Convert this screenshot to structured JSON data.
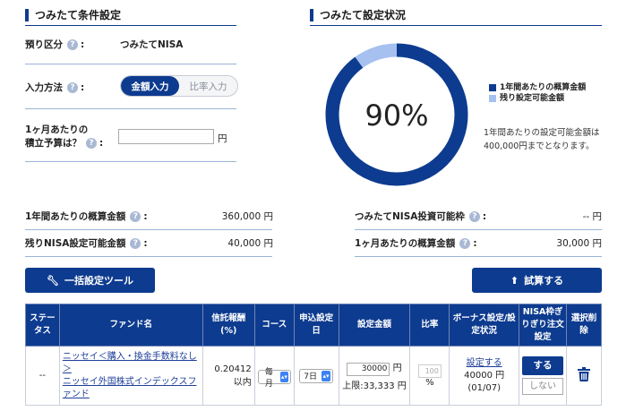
{
  "left": {
    "title": "つみたて条件設定",
    "account_label": "預り区分",
    "account_value": "つみたてNISA",
    "input_method_label": "入力方法",
    "method_amount": "金額入力",
    "method_ratio": "比率入力",
    "budget_label_1": "1ヶ月あたりの",
    "budget_label_2": "積立予算は？",
    "budget_unit": "円",
    "annual_label": "1年間あたりの概算金額",
    "annual_value": "360,000 円",
    "remain_label": "残りNISA設定可能金額",
    "remain_value": "40,000 円",
    "bulk_tool": "一括設定ツール"
  },
  "right": {
    "title": "つみたて設定状況",
    "percent": "90%",
    "percent_value": 90,
    "legend_annual": "1年間あたりの概算金額",
    "legend_remain": "残り設定可能金額",
    "note_1": "1年間あたりの設定可能金額は",
    "note_2": "400,000円までとなります。",
    "invest_limit_label": "つみたてNISA投資可能枠",
    "invest_limit_value": "-- 円",
    "monthly_label": "1ヶ月あたりの概算金額",
    "monthly_value": "30,000 円",
    "trial_button": "試算する"
  },
  "colors": {
    "primary": "#0d3b8f",
    "light": "#a6c0f0"
  },
  "icons": {
    "help": "question-icon",
    "wrench": "wrench-icon",
    "arrow": "arrow-circle-icon",
    "trash": "trash-icon"
  },
  "table": {
    "headers": [
      "ステータス",
      "ファンド名",
      "信託報酬(%)",
      "コース",
      "申込設定日",
      "設定金額",
      "比率",
      "ボーナス設定/設定状況",
      "NISA枠ぎりぎり注文設定",
      "選択削除"
    ],
    "row": {
      "status": "--",
      "fund_1": "ニッセイ＜購入・換金手数料なし＞",
      "fund_2": "ニッセイ外国株式インデックスファンド",
      "fee": "0.20412",
      "fee_note": "以内",
      "course": "毎月",
      "day": "7日",
      "amount": "30000",
      "amount_unit": "円",
      "limit": "上限:33,333 円",
      "ratio": "100",
      "ratio_unit": "%",
      "bonus_link": "設定する",
      "bonus_amount": "40000 円",
      "bonus_date": "(01/07)",
      "do": "する",
      "dont": "しない"
    }
  }
}
